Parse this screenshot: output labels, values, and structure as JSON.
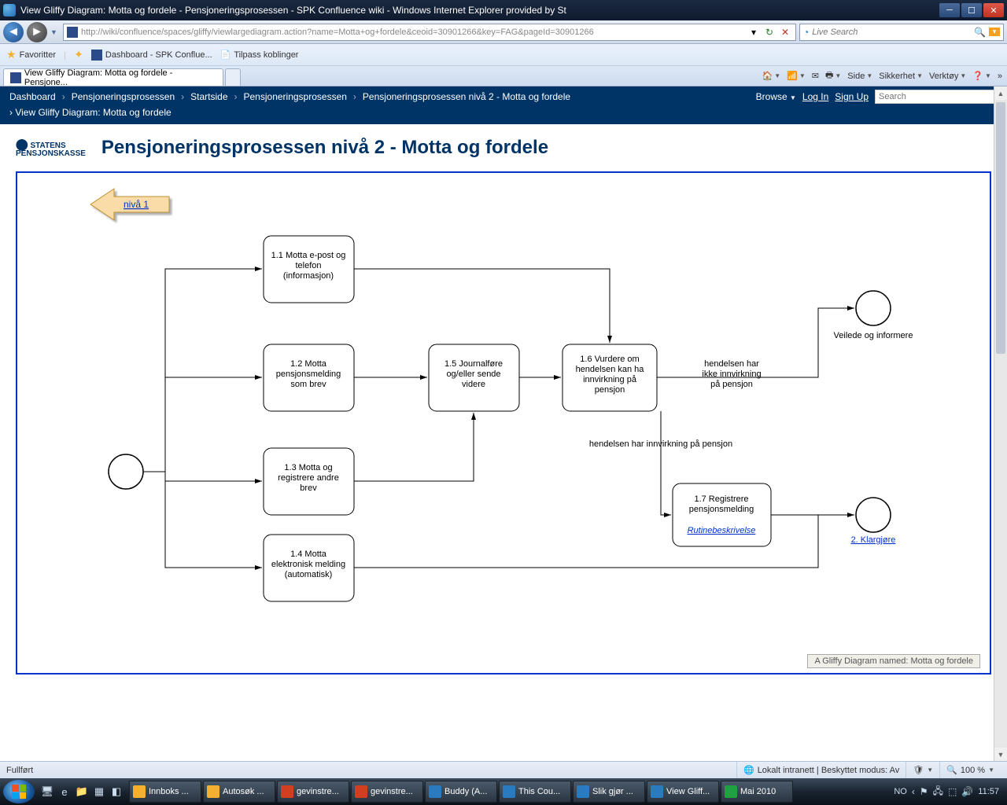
{
  "window": {
    "title": "View Gliffy Diagram: Motta og fordele - Pensjoneringsprosessen - SPK Confluence wiki - Windows Internet Explorer provided by St"
  },
  "nav": {
    "url": "http://wiki/confluence/spaces/gliffy/viewlargediagram.action?name=Motta+og+fordele&ceoid=30901266&key=FAG&pageId=30901266",
    "search_placeholder": "Live Search"
  },
  "favorites": {
    "label": "Favoritter",
    "items": [
      "Dashboard - SPK Conflue...",
      "Tilpass koblinger"
    ]
  },
  "tabs": {
    "active": "View Gliffy Diagram: Motta og fordele - Pensjone...",
    "tools": [
      "Side",
      "Sikkerhet",
      "Verktøy"
    ]
  },
  "confluence": {
    "crumbs": [
      "Dashboard",
      "Pensjoneringsprosessen",
      "Startside",
      "Pensjoneringsprosessen",
      "Pensjoneringsprosessen nivå 2 - Motta og fordele"
    ],
    "crumb2": "View Gliffy Diagram: Motta og fordele",
    "browse": "Browse",
    "login": "Log In",
    "signup": "Sign Up",
    "search_placeholder": "Search"
  },
  "page": {
    "logo": "STATENS\nPENSJONSKASSE",
    "title": "Pensjoneringsprosessen nivå 2 - Motta og fordele"
  },
  "diagram": {
    "back_link": "nivå 1",
    "nodes": {
      "n11": "1.1 Motta e-post og\ntelefon\n(informasjon)",
      "n12": "1.2 Motta\npensjonsmelding\nsom brev",
      "n13": "1.3 Motta og\nregistrere andre\nbrev",
      "n14": "1.4 Motta\nelektronisk melding\n(automatisk)",
      "n15": "1.5 Journalføre\nog/eller sende\nvidere",
      "n16": "1.6 Vurdere om\nhendelsen kan ha\ninnvirkning på\npensjon",
      "n17_a": "1.7 Registrere\npensjonsmelding",
      "n17_link": "Rutinebeskrivelse",
      "end1_label": "Veilede og informere",
      "end2_link": "2. Klargjøre",
      "edge_no": "hendelsen har\nikke innvirkning\npå pensjon",
      "edge_yes": "hendelsen har innvirkning på pensjon"
    },
    "caption": "A Gliffy Diagram named: Motta og fordele"
  },
  "status": {
    "left": "Fullført",
    "zone": "Lokalt intranett | Beskyttet modus: Av",
    "zoom": "100 %"
  },
  "taskbar": {
    "items": [
      "Innboks ...",
      "Autosøk ...",
      "gevinstre...",
      "gevinstre...",
      "Buddy (A...",
      "This Cou...",
      "Slik gjør ...",
      "View Gliff...",
      "Mai 2010"
    ],
    "lang": "NO",
    "time": "11:57"
  }
}
